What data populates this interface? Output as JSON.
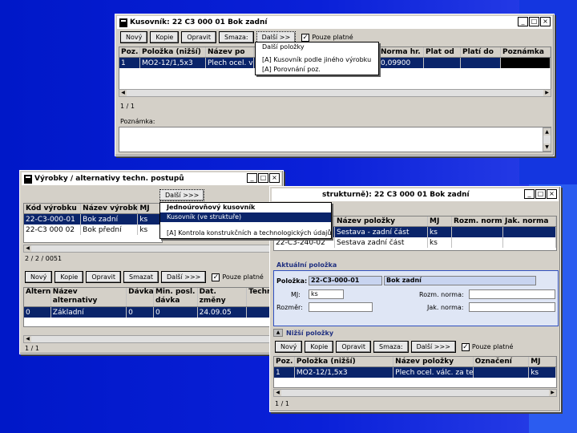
{
  "colors": {
    "desktop": "#0018c8",
    "selection": "#0a246a",
    "accent_shape": "#2b5cf0"
  },
  "w1": {
    "title": "Kusovník: 22 C3 000 01 Bok zadní",
    "toolbar": {
      "new": "Nový",
      "copy": "Kopie",
      "edit": "Opravit",
      "delete": "Smaza:",
      "more": "Další >>",
      "checkbox": "Pouze platné"
    },
    "columns": [
      "Poz.",
      "Položka (nižší)",
      "Název po",
      "č.",
      "Norma hr.",
      "Plat od",
      "Platí do",
      "Poznámka"
    ],
    "row": [
      "1",
      "MO2-12/1,5x3",
      "Plech ocel. vá",
      "01",
      "0,09900",
      "",
      "",
      ""
    ],
    "counter": "1 / 1",
    "notes_label": "Poznámka:",
    "menu": [
      "Další položky",
      "[A] Kusovník podle jiného výrobku",
      "[A] Porovnání poz."
    ]
  },
  "w2": {
    "title": "Výrobky / alternativy techn. postupů",
    "columns": [
      "Kód výrobku",
      "Název výrobku",
      "MJ"
    ],
    "rows": [
      [
        "22-C3-000-01",
        "Bok zadní",
        "ks"
      ],
      [
        "22-C3 000 02",
        "Bok přední",
        "ks"
      ]
    ],
    "counter": "2 / 2 / 0051",
    "more_btn": "Další >>>",
    "menu": [
      "Jednoúrovňový kusovník",
      "Kusovník (ve struktuře)",
      "[A] Kontrola konstrukčních a technologických údajů"
    ],
    "toolbar": {
      "new": "Nový",
      "copy": "Kopie",
      "edit": "Opravit",
      "delete": "Smazat",
      "more": "Další >>>",
      "checkbox": "Pouze platné"
    },
    "alt_columns": [
      "Altern.",
      "Název alternativy",
      "Dávka",
      "Min. posl. dávka",
      "Dat. změny",
      "Techn"
    ],
    "alt_row": [
      "0",
      "Základní",
      "0",
      "0",
      "24.09.05",
      ""
    ],
    "alt_counter": "1 / 1"
  },
  "w3": {
    "title": "strukturně): 22 C3 000 01 Bok zadní",
    "columns": [
      "",
      "Název položky",
      "MJ",
      "Rozm. norma",
      "Jak. norma"
    ],
    "rows": [
      [
        "",
        "Sestava - zadní část",
        "ks",
        "",
        ""
      ],
      [
        "22-C3-240-02",
        "Sestava zadní část",
        "ks",
        "",
        ""
      ]
    ],
    "current_title": "Aktuální položka",
    "item_label": "Položka:",
    "item_code": "22-C3-000-01",
    "item_name": "Bok zadní",
    "mj_label": "MJ:",
    "mj_value": "ks",
    "rozm_label": "Rozměr:",
    "rozm_norma_label": "Rozm. norma:",
    "jak_norma_label": "Jak. norma:",
    "lower_title": "Nižší položky",
    "toolbar": {
      "new": "Nový",
      "copy": "Kopie",
      "edit": "Opravit",
      "delete": "Smaza:",
      "more": "Další >>>",
      "checkbox": "Pouze platné"
    },
    "lower_columns": [
      "Poz.",
      "Položka (nižší)",
      "Název položky",
      "Označení",
      "MJ"
    ],
    "lower_row": [
      "1",
      "MO2-12/1,5x3",
      "Plech ocel. válc. za tepla",
      "",
      "ks"
    ],
    "counter": "1 / 1"
  }
}
